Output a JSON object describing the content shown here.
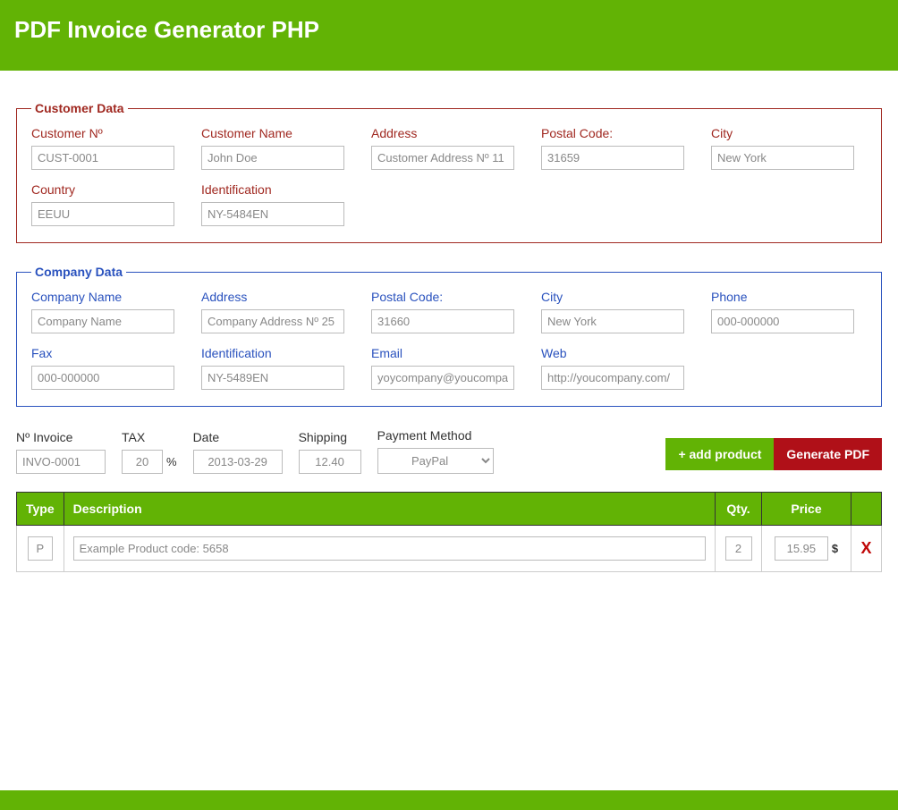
{
  "header": {
    "title": "PDF Invoice Generator PHP"
  },
  "customer": {
    "legend": "Customer Data",
    "fields": {
      "number": {
        "label": "Customer Nº",
        "value": "CUST-0001"
      },
      "name": {
        "label": "Customer Name",
        "value": "John Doe"
      },
      "address": {
        "label": "Address",
        "value": "Customer Address Nº 11"
      },
      "postal": {
        "label": "Postal Code:",
        "value": "31659"
      },
      "city": {
        "label": "City",
        "value": "New York"
      },
      "country": {
        "label": "Country",
        "value": "EEUU"
      },
      "identification": {
        "label": "Identification",
        "value": "NY-5484EN"
      }
    }
  },
  "company": {
    "legend": "Company Data",
    "fields": {
      "name": {
        "label": "Company Name",
        "value": "Company Name"
      },
      "address": {
        "label": "Address",
        "value": "Company Address Nº 25"
      },
      "postal": {
        "label": "Postal Code:",
        "value": "31660"
      },
      "city": {
        "label": "City",
        "value": "New York"
      },
      "phone": {
        "label": "Phone",
        "value": "000-000000"
      },
      "fax": {
        "label": "Fax",
        "value": "000-000000"
      },
      "identification": {
        "label": "Identification",
        "value": "NY-5489EN"
      },
      "email": {
        "label": "Email",
        "value": "yoycompany@youcompany.com"
      },
      "web": {
        "label": "Web",
        "value": "http://youcompany.com/"
      }
    }
  },
  "invoice": {
    "number": {
      "label": "Nº Invoice",
      "value": "INVO-0001"
    },
    "tax": {
      "label": "TAX",
      "value": "20",
      "suffix": "%"
    },
    "date": {
      "label": "Date",
      "value": "2013-03-29"
    },
    "shipping": {
      "label": "Shipping",
      "value": "12.40"
    },
    "payment": {
      "label": "Payment Method",
      "value": "PayPal"
    }
  },
  "actions": {
    "add_product": "+ add product",
    "generate_pdf": "Generate PDF"
  },
  "table": {
    "headers": {
      "type": "Type",
      "description": "Description",
      "qty": "Qty.",
      "price": "Price",
      "delete": ""
    },
    "currency": "$",
    "delete_symbol": "X",
    "rows": [
      {
        "type": "P",
        "description": "Example Product code: 5658",
        "qty": "2",
        "price": "15.95"
      }
    ]
  }
}
